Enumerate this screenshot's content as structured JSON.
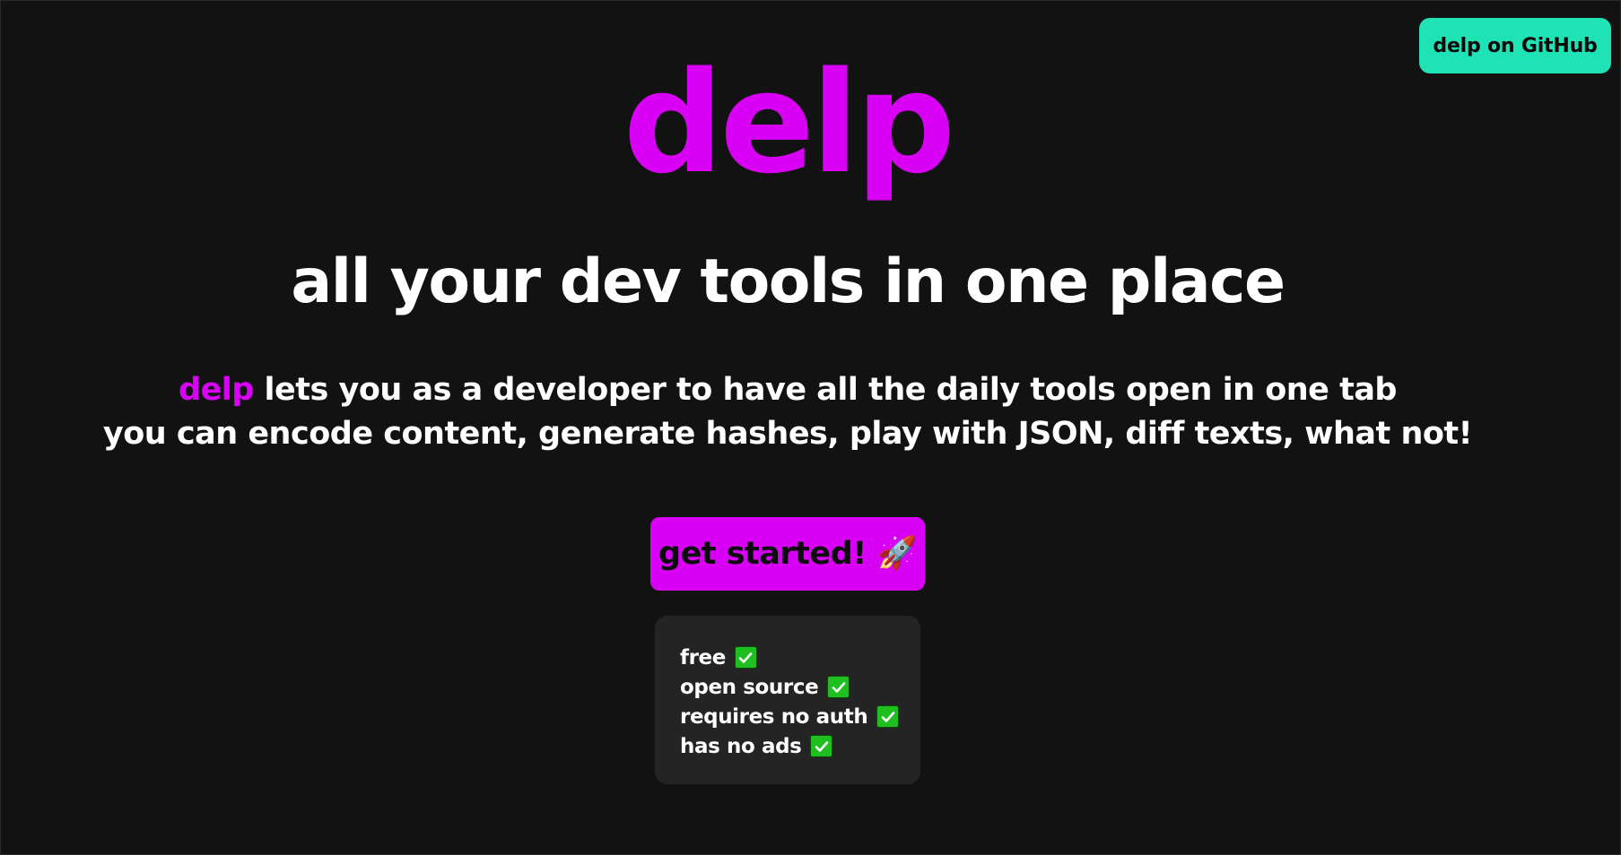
{
  "header": {
    "github_label": "delp on GitHub"
  },
  "hero": {
    "logo": "delp",
    "tagline": "all your dev tools in one place",
    "desc_brand": "delp",
    "desc_line1_rest": " lets you as a developer to have all the daily tools open in one tab",
    "desc_line2": "you can encode content, generate hashes, play with JSON, diff texts, what not!",
    "cta_label": "get started!",
    "cta_icon": "🚀"
  },
  "features": [
    {
      "label": "free",
      "icon": "check-icon"
    },
    {
      "label": "open source",
      "icon": "check-icon"
    },
    {
      "label": "requires no auth",
      "icon": "check-icon"
    },
    {
      "label": "has no ads",
      "icon": "check-icon"
    }
  ],
  "colors": {
    "background": "#131213",
    "brand": "#d800f5",
    "github_button": "#1fe3b5",
    "features_card": "#252425",
    "check": "#1fbf1f"
  }
}
